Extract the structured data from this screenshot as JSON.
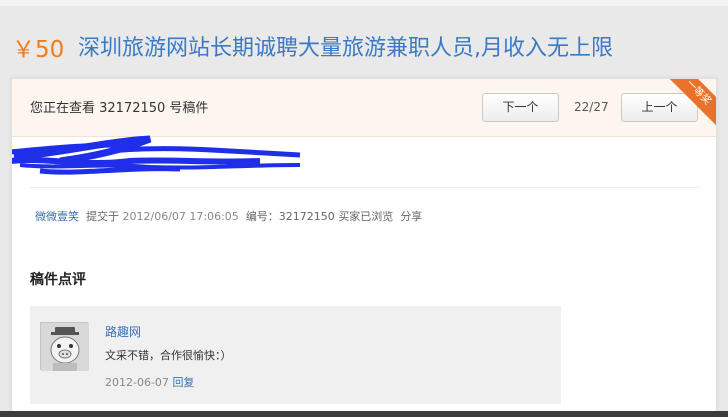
{
  "header": {
    "price": "￥50",
    "title": "深圳旅游网站长期诚聘大量旅游兼职人员,月收入无上限"
  },
  "notice": {
    "text": "您正在查看 32172150 号稿件",
    "next_label": "下一个",
    "page_count": "22/27",
    "prev_label": "上一个",
    "ribbon": "一等奖"
  },
  "meta": {
    "author": "微微壹笑",
    "submitted_prefix": "提交于",
    "submitted_date": "2012/06/07 17:06:05",
    "number_label": "编号：32172150",
    "status": "买家已浏览",
    "share": "分享"
  },
  "comments": {
    "section_title": "稿件点评",
    "items": [
      {
        "reviewer": "路趣网",
        "text": "文采不错，合作很愉快：）",
        "date": "2012-06-07",
        "reply_label": "回复"
      }
    ]
  },
  "colors": {
    "price": "#f07d18",
    "title": "#3a7ac5",
    "ribbon": "#e8722a",
    "scribble": "#1f2ee8",
    "link": "#3a6fb0"
  }
}
